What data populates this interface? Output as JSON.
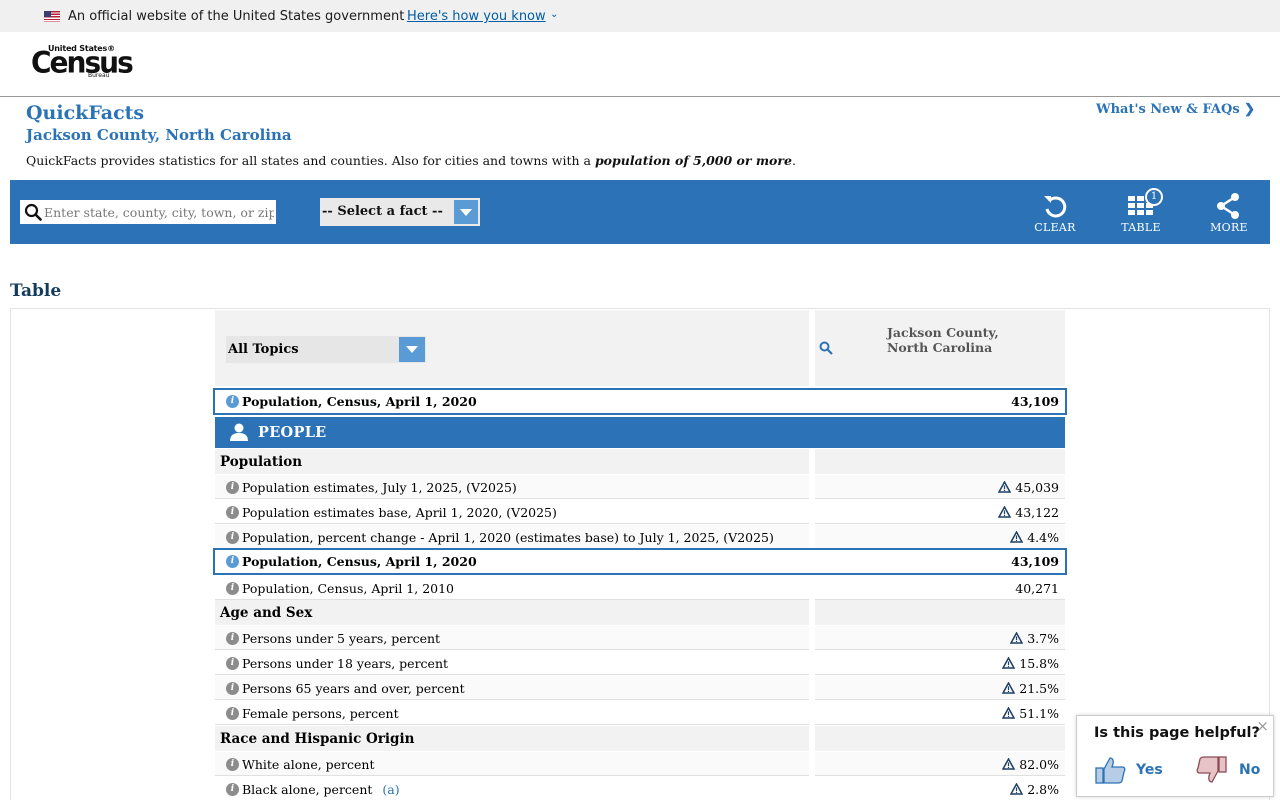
{
  "gov_banner": {
    "text": "An official website of the United States government",
    "link": "Here's how you know"
  },
  "logo": {
    "top": "United States®",
    "main": "Census",
    "bottom": "Bureau"
  },
  "header": {
    "title": "QuickFacts",
    "subtitle": "Jackson County, North Carolina",
    "desc_prefix": "QuickFacts provides statistics for all states and counties. Also for cities and towns with a ",
    "desc_bold": "population of 5,000 or more",
    "desc_suffix": ".",
    "whats_new": "What's New & FAQs"
  },
  "toolbar": {
    "search_placeholder": "Enter state, county, city, town, or zip code",
    "fact_select": "-- Select a fact --",
    "clear": "CLEAR",
    "table": "TABLE",
    "table_badge": "1",
    "more": "MORE"
  },
  "section_title": "Table",
  "table": {
    "topic_select": "All Topics",
    "geo_name": "Jackson County, North Carolina",
    "pinned": {
      "label": "Population, Census, April 1, 2020",
      "value": "43,109"
    },
    "people_header": "PEOPLE",
    "categories": [
      "Population",
      "Age and Sex",
      "Race and Hispanic Origin"
    ],
    "rows": [
      {
        "label": "Population estimates, July 1, 2025, (V2025)",
        "value": "45,039"
      },
      {
        "label": "Population estimates base, April 1, 2020, (V2025)",
        "value": "43,122"
      },
      {
        "label": "Population, percent change - April 1, 2020 (estimates base) to July 1, 2025, (V2025)",
        "value": "4.4%"
      },
      {
        "label": "Population, Census, April 1, 2020",
        "value": "43,109"
      },
      {
        "label": "Population, Census, April 1, 2010",
        "value": "40,271"
      },
      {
        "label": "Persons under 5 years, percent",
        "value": "3.7%"
      },
      {
        "label": "Persons under 18 years, percent",
        "value": "15.8%"
      },
      {
        "label": "Persons 65 years and over, percent",
        "value": "21.5%"
      },
      {
        "label": "Female persons, percent",
        "value": "51.1%"
      },
      {
        "label": "White alone, percent",
        "value": "82.0%"
      },
      {
        "label": "Black alone, percent",
        "value": "2.8%",
        "note": "(a)"
      }
    ]
  },
  "feedback": {
    "question": "Is this page helpful?",
    "yes": "Yes",
    "no": "No",
    "close": "×"
  },
  "colors": {
    "brand_blue": "#2b73b6",
    "light_blue": "#5b9bd5",
    "title_navy": "#133b5e"
  }
}
